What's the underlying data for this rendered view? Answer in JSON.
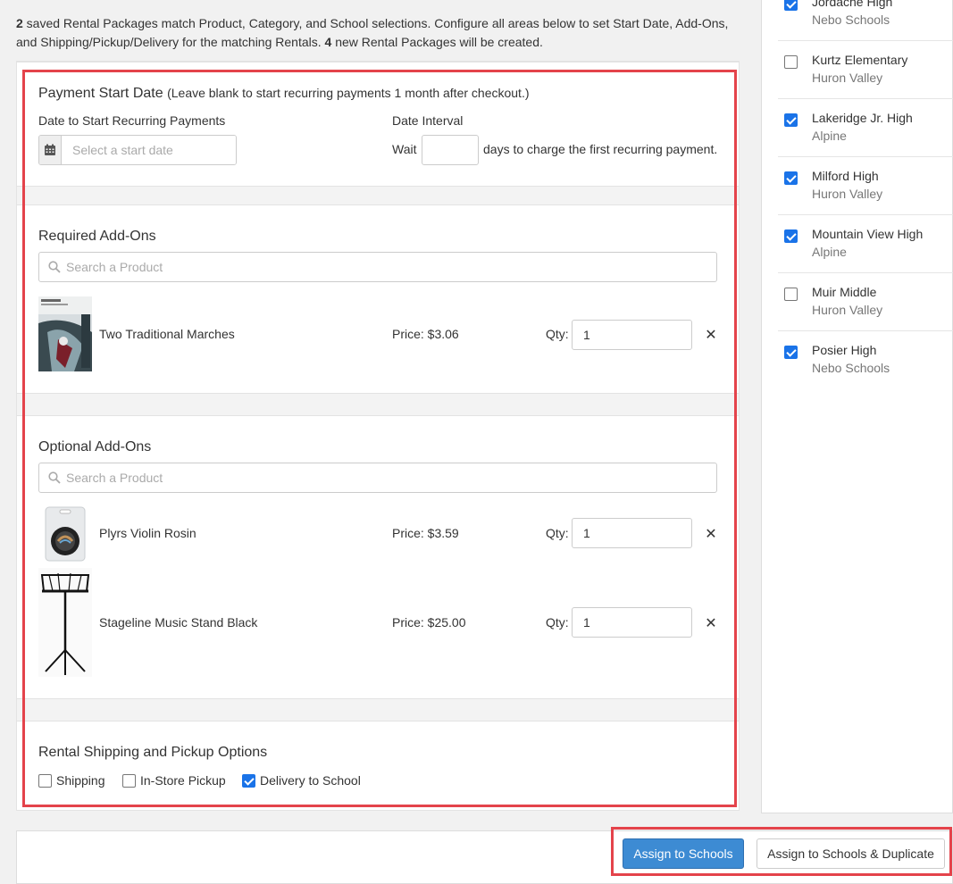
{
  "intro": {
    "count_saved": "2",
    "text_a": " saved Rental Packages match Product, Category, and School selections. Configure all areas below to set Start Date, Add-Ons, and Shipping/Pickup/Delivery for the matching Rentals. ",
    "count_new": "4",
    "text_b": " new Rental Packages will be created."
  },
  "payment": {
    "title": "Payment Start Date",
    "note": "(Leave blank to start recurring payments 1 month after checkout.)",
    "date_label": "Date to Start Recurring Payments",
    "date_placeholder": "Select a start date",
    "interval_label": "Date Interval",
    "wait_label": "Wait",
    "wait_value": "",
    "days_text": "days to charge the first recurring payment."
  },
  "required": {
    "title": "Required Add-Ons",
    "search_placeholder": "Search a Product",
    "products": [
      {
        "name": "Two Traditional Marches",
        "price": "Price: $3.06",
        "qty_label": "Qty:",
        "qty": "1",
        "remove": "✕"
      }
    ]
  },
  "optional": {
    "title": "Optional Add-Ons",
    "search_placeholder": "Search a Product",
    "products": [
      {
        "name": "Plyrs Violin Rosin",
        "price": "Price: $3.59",
        "qty_label": "Qty:",
        "qty": "1",
        "remove": "✕"
      },
      {
        "name": "Stageline Music Stand Black",
        "price": "Price: $25.00",
        "qty_label": "Qty:",
        "qty": "1",
        "remove": "✕"
      }
    ]
  },
  "shipping": {
    "title": "Rental Shipping and Pickup Options",
    "options": [
      {
        "label": "Shipping",
        "checked": false
      },
      {
        "label": "In-Store Pickup",
        "checked": false
      },
      {
        "label": "Delivery to School",
        "checked": true
      }
    ]
  },
  "schools": [
    {
      "name": "Jordache High",
      "district": "Nebo Schools",
      "checked": true
    },
    {
      "name": "Kurtz Elementary",
      "district": "Huron Valley",
      "checked": false
    },
    {
      "name": "Lakeridge Jr. High",
      "district": "Alpine",
      "checked": true
    },
    {
      "name": "Milford High",
      "district": "Huron Valley",
      "checked": true
    },
    {
      "name": "Mountain View High",
      "district": "Alpine",
      "checked": true
    },
    {
      "name": "Muir Middle",
      "district": "Huron Valley",
      "checked": false
    },
    {
      "name": "Posier High",
      "district": "Nebo Schools",
      "checked": true
    }
  ],
  "footer": {
    "assign_label": "Assign to Schools",
    "assign_dup_label": "Assign to Schools & Duplicate"
  },
  "colors": {
    "primary": "#3d8bd3",
    "checkbox": "#1a73e8",
    "highlight": "#e4434b"
  }
}
